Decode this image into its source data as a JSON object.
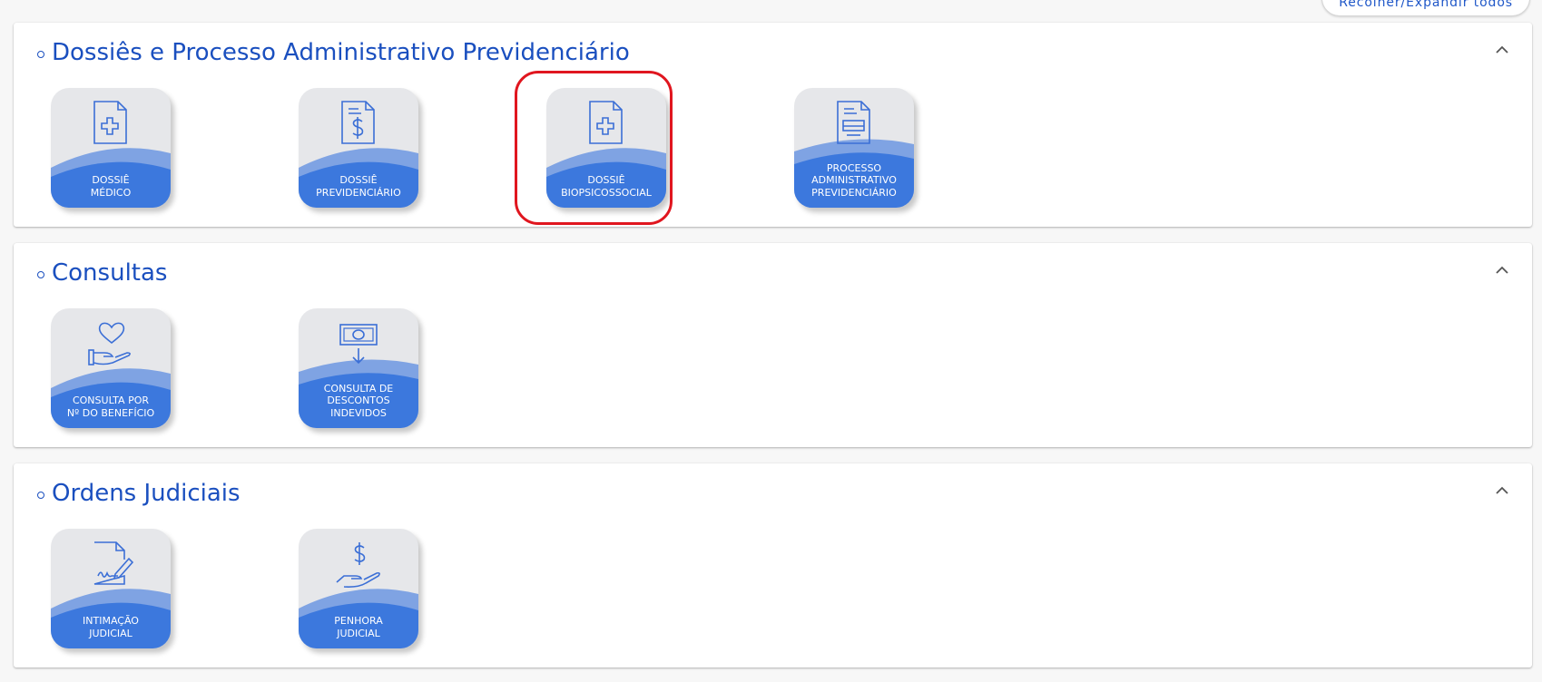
{
  "top_button": {
    "label": "Recolher/Expandir todos"
  },
  "colors": {
    "accent": "#1a4fbf",
    "tile_bg": "#e6e7ea",
    "tile_blue": "#3c78dd",
    "tile_blue_light": "#7fa3e3",
    "highlight": "#e0161f"
  },
  "sections": [
    {
      "title": "Dossiês e Processo Administrativo Previdenciário",
      "tiles": [
        {
          "line1": "DOSSIÊ",
          "line2": "MÉDICO",
          "line3": "",
          "icon": "medical-document-icon"
        },
        {
          "line1": "DOSSIÊ",
          "line2": "PREVIDENCIÁRIO",
          "line3": "",
          "icon": "dollar-document-icon"
        },
        {
          "line1": "DOSSIÊ",
          "line2": "BIOPSICOSSOCIAL",
          "line3": "",
          "icon": "medical-document-icon"
        },
        {
          "line1": "PROCESSO",
          "line2": "ADMINISTRATIVO",
          "line3": "PREVIDENCIÁRIO",
          "icon": "form-document-icon"
        }
      ]
    },
    {
      "title": "Consultas",
      "tiles": [
        {
          "line1": "CONSULTA POR",
          "line2": "Nº DO BENEFÍCIO",
          "line3": "",
          "icon": "heart-hand-icon"
        },
        {
          "line1": "CONSULTA DE",
          "line2": "DESCONTOS",
          "line3": "INDEVIDOS",
          "icon": "money-down-icon"
        }
      ]
    },
    {
      "title": "Ordens Judiciais",
      "tiles": [
        {
          "line1": "INTIMAÇÃO",
          "line2": "JUDICIAL",
          "line3": "",
          "icon": "signed-document-icon"
        },
        {
          "line1": "PENHORA",
          "line2": "JUDICIAL",
          "line3": "",
          "icon": "dollar-hand-icon"
        }
      ]
    }
  ]
}
